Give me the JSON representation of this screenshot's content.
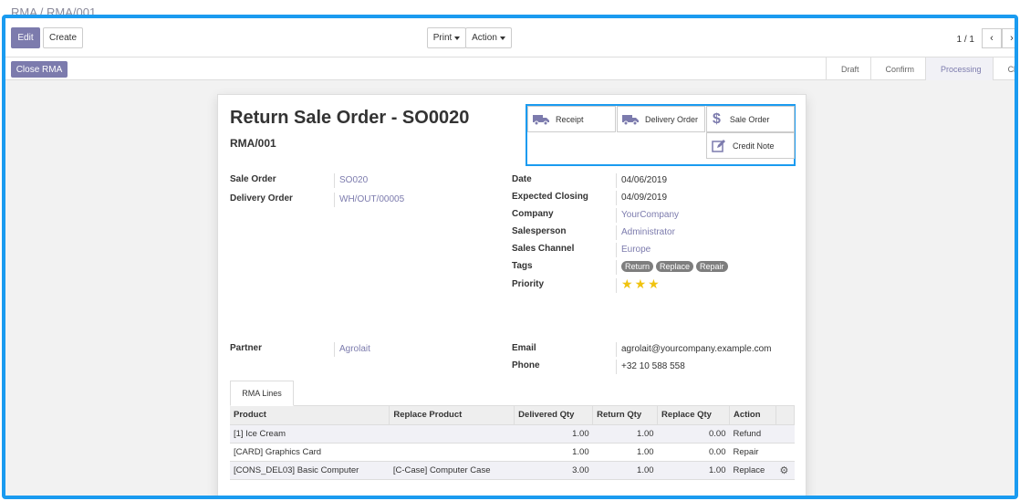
{
  "breadcrumb": "RMA / RMA/001",
  "control_panel": {
    "edit_label": "Edit",
    "create_label": "Create",
    "print_label": "Print",
    "action_label": "Action",
    "pager": "1 / 1"
  },
  "status": {
    "close_rma_label": "Close RMA",
    "stages": [
      "Draft",
      "Confirm",
      "Processing",
      "Close"
    ],
    "active_stage": "Processing"
  },
  "form": {
    "title": "Return Sale Order - SO0020",
    "subtitle": "RMA/001",
    "smart_buttons": {
      "receipt": "Receipt",
      "delivery_order": "Delivery Order",
      "sale_order": "Sale Order",
      "credit_note": "Credit Note"
    },
    "left_fields": [
      {
        "label": "Sale Order",
        "value": "SO020"
      },
      {
        "label": "Delivery Order",
        "value": "WH/OUT/00005"
      }
    ],
    "right_fields": [
      {
        "label": "Date",
        "value": "04/06/2019"
      },
      {
        "label": "Expected Closing",
        "value": "04/09/2019"
      },
      {
        "label": "Company",
        "value": "YourCompany"
      },
      {
        "label": "Salesperson",
        "value": "Administrator"
      },
      {
        "label": "Sales Channel",
        "value": "Europe"
      },
      {
        "label": "Tags",
        "value": ""
      },
      {
        "label": "Priority",
        "value": ""
      }
    ],
    "tags": [
      "Return",
      "Replace",
      "Repair"
    ],
    "priority_stars": 3,
    "partner": {
      "label": "Partner",
      "value": "Agrolait"
    },
    "contact": [
      {
        "label": "Email",
        "value": "agrolait@yourcompany.example.com"
      },
      {
        "label": "Phone",
        "value": "+32 10 588 558"
      }
    ],
    "tab_label": "RMA Lines",
    "table": {
      "headers": [
        "Product",
        "Replace Product",
        "Delivered Qty",
        "Return Qty",
        "Replace Qty",
        "Action"
      ],
      "rows": [
        [
          "[1] Ice Cream",
          "",
          "1.00",
          "1.00",
          "0.00",
          "Refund"
        ],
        [
          "[CARD] Graphics Card",
          "",
          "1.00",
          "1.00",
          "0.00",
          "Repair"
        ],
        [
          "[CONS_DEL03] Basic Computer",
          "[C-Case] Computer Case",
          "3.00",
          "1.00",
          "1.00",
          "Replace"
        ]
      ]
    }
  },
  "colors": {
    "accent": "#7c7bad",
    "highlight_border": "#1a9bf0",
    "star": "#f0c30f"
  }
}
